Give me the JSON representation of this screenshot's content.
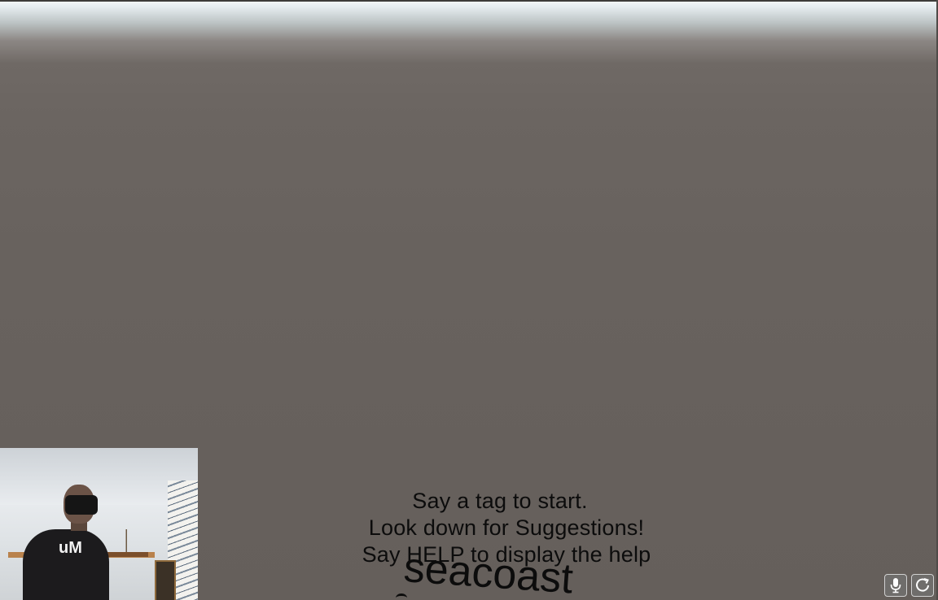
{
  "scene": {
    "instructions": [
      "Say a tag to start.",
      "Look down for Suggestions!",
      "Say HELP to display the help"
    ],
    "suggestion_word": "seacoast"
  },
  "webcam": {
    "shirt_logo": "uM"
  },
  "controls": {
    "mic_icon": "microphone-icon",
    "reset_icon": "refresh-icon"
  }
}
